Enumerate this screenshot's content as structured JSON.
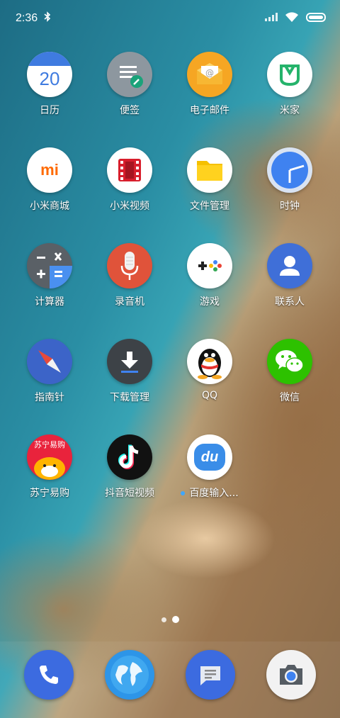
{
  "status_bar": {
    "time": "2:36"
  },
  "apps": [
    {
      "id": "calendar",
      "label": "日历",
      "icon": "calendar-icon",
      "date": "20"
    },
    {
      "id": "notes",
      "label": "便签",
      "icon": "notes-icon"
    },
    {
      "id": "email",
      "label": "电子邮件",
      "icon": "email-icon"
    },
    {
      "id": "mijia",
      "label": "米家",
      "icon": "mijia-icon"
    },
    {
      "id": "mi-store",
      "label": "小米商城",
      "icon": "mi-store-icon",
      "logo": "mi"
    },
    {
      "id": "mi-video",
      "label": "小米视频",
      "icon": "video-icon"
    },
    {
      "id": "files",
      "label": "文件管理",
      "icon": "folder-icon"
    },
    {
      "id": "clock",
      "label": "时钟",
      "icon": "clock-icon"
    },
    {
      "id": "calculator",
      "label": "计算器",
      "icon": "calculator-icon"
    },
    {
      "id": "recorder",
      "label": "录音机",
      "icon": "microphone-icon"
    },
    {
      "id": "games",
      "label": "游戏",
      "icon": "gamepad-icon"
    },
    {
      "id": "contacts",
      "label": "联系人",
      "icon": "contacts-icon"
    },
    {
      "id": "compass",
      "label": "指南针",
      "icon": "compass-icon"
    },
    {
      "id": "downloads",
      "label": "下载管理",
      "icon": "download-icon"
    },
    {
      "id": "qq",
      "label": "QQ",
      "icon": "qq-penguin-icon"
    },
    {
      "id": "wechat",
      "label": "微信",
      "icon": "wechat-icon"
    },
    {
      "id": "suning",
      "label": "苏宁易购",
      "icon": "suning-icon",
      "logo": "苏宁易购"
    },
    {
      "id": "douyin",
      "label": "抖音短视频",
      "icon": "tiktok-icon"
    },
    {
      "id": "baidu-input",
      "label": "百度输入...",
      "icon": "baidu-input-icon",
      "logo": "du",
      "has_new_badge": true
    }
  ],
  "pager": {
    "pages": 2,
    "current": 2
  },
  "dock": [
    {
      "id": "phone",
      "icon": "phone-icon"
    },
    {
      "id": "browser",
      "icon": "globe-icon"
    },
    {
      "id": "messages",
      "icon": "message-icon"
    },
    {
      "id": "camera",
      "icon": "camera-icon"
    }
  ],
  "colors": {
    "contacts_blue": "#3f6fd8",
    "wechat_green": "#2dc100",
    "recorder_red": "#e0533a",
    "email_orange": "#f6a623"
  }
}
